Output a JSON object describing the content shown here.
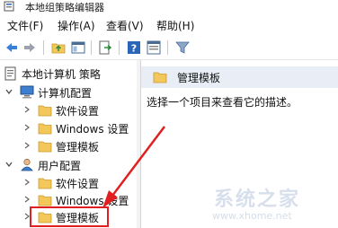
{
  "window": {
    "title": "本地组策略编辑器"
  },
  "menu": [
    "文件(F)",
    "操作(A)",
    "查看(V)",
    "帮助(H)"
  ],
  "toolbar": {
    "buttons": [
      "back-arrow-icon",
      "forward-arrow-icon",
      "up-folder-icon",
      "show-hide-tree-icon",
      "export-list-icon",
      "help-icon",
      "properties-icon",
      "filter-icon"
    ]
  },
  "tree": {
    "root": "本地计算机 策略",
    "computer_config": "计算机配置",
    "computer_items": [
      "软件设置",
      "Windows 设置",
      "管理模板"
    ],
    "user_config": "用户配置",
    "user_items": [
      "软件设置",
      "Windows 设置",
      "管理模板"
    ],
    "selected": "管理模板"
  },
  "detail": {
    "header": "管理模板",
    "description": "选择一个项目来查看它的描述。"
  },
  "watermark": {
    "text": "系统之家",
    "url": "www.xhome.net"
  },
  "colors": {
    "folder_yellow": "#f3c75a",
    "highlight_red": "#e02020",
    "header_bg": "#e9eef6",
    "accent_blue": "#2a66b8"
  }
}
